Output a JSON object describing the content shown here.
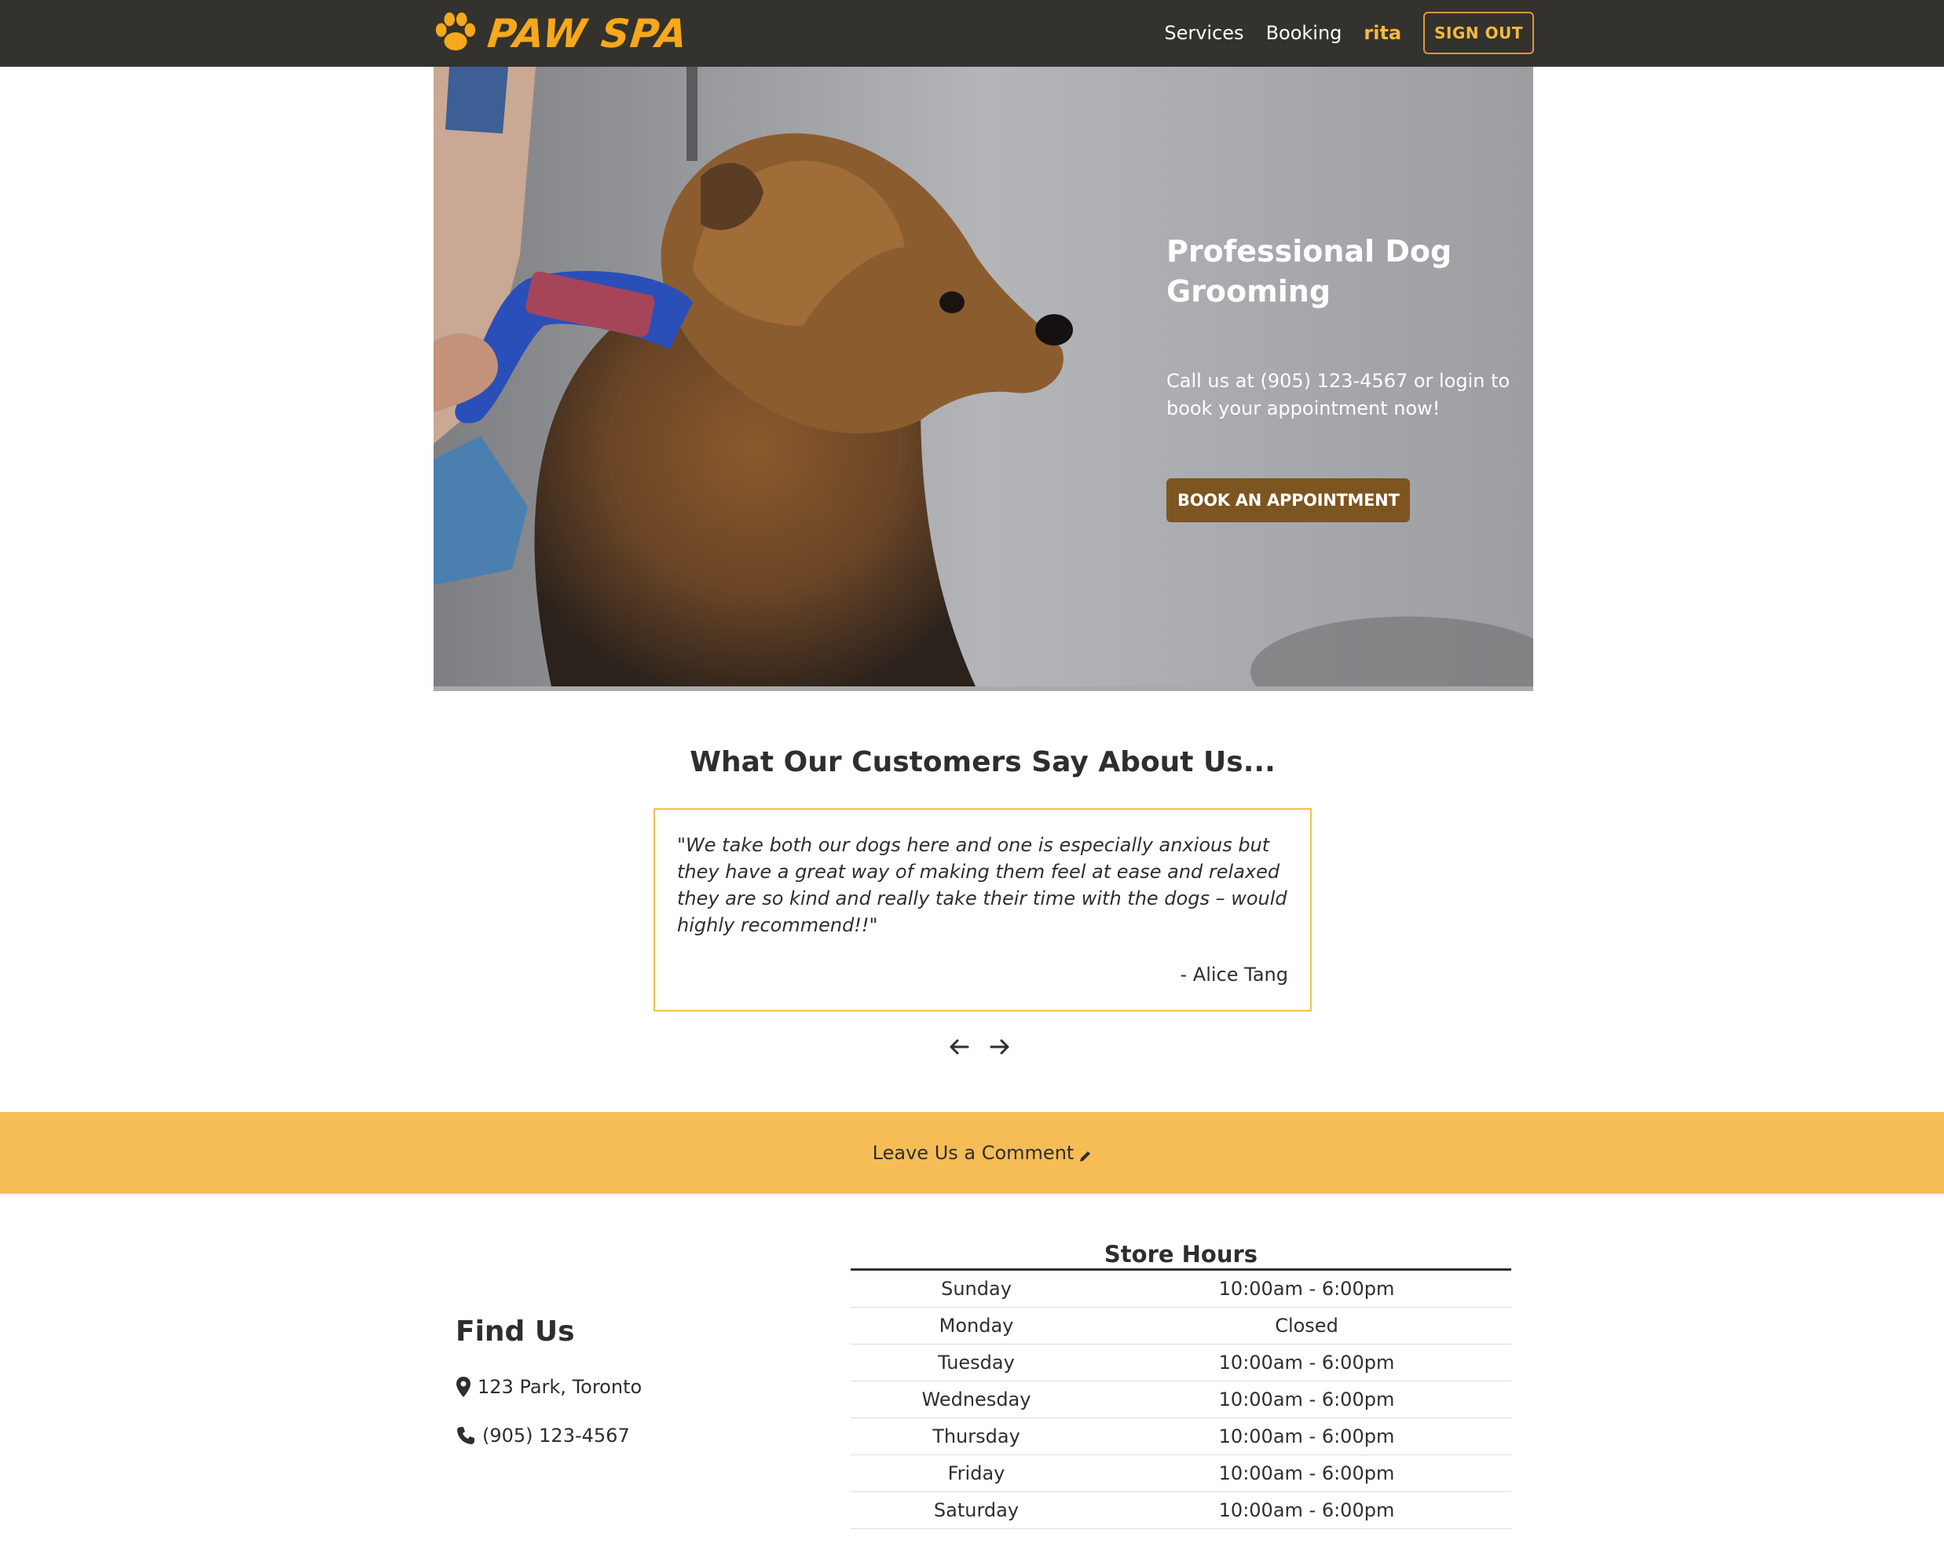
{
  "nav": {
    "brand": "PAW SPA",
    "links": [
      "Services",
      "Booking"
    ],
    "user": "rita",
    "signout": "SIGN OUT"
  },
  "hero": {
    "title": "Professional Dog Grooming",
    "subtitle": "Call us at (905) 123-4567 or login to book your appointment now!",
    "button": "BOOK AN APPOINTMENT"
  },
  "testimonials": {
    "title": "What Our Customers Say About Us...",
    "quote": "\"We take both our dogs here and one is especially anxious but they have a great way of making them feel at ease and relaxed they are so kind and really take their time with the dogs – would highly recommend!!\"",
    "author": "- Alice Tang"
  },
  "comment": {
    "label": "Leave Us a Comment"
  },
  "findus": {
    "title": "Find Us",
    "address": "123 Park, Toronto",
    "phone": "(905) 123-4567"
  },
  "hours": {
    "title": "Store Hours",
    "rows": [
      {
        "day": "Sunday",
        "time": "10:00am - 6:00pm"
      },
      {
        "day": "Monday",
        "time": "Closed"
      },
      {
        "day": "Tuesday",
        "time": "10:00am - 6:00pm"
      },
      {
        "day": "Wednesday",
        "time": "10:00am - 6:00pm"
      },
      {
        "day": "Thursday",
        "time": "10:00am - 6:00pm"
      },
      {
        "day": "Friday",
        "time": "10:00am - 6:00pm"
      },
      {
        "day": "Saturday",
        "time": "10:00am - 6:00pm"
      }
    ]
  },
  "colors": {
    "navbar": "#34322e",
    "brand": "#f7a81b",
    "accent_yellow": "#f6bd57",
    "button_brown": "#7d5520",
    "card_border": "#f5c04a"
  },
  "icons": {
    "brand": "paw-icon",
    "prev": "arrow-left-icon",
    "next": "arrow-right-icon",
    "comment": "pencil-icon",
    "address": "map-marker-icon",
    "phone": "phone-icon"
  }
}
